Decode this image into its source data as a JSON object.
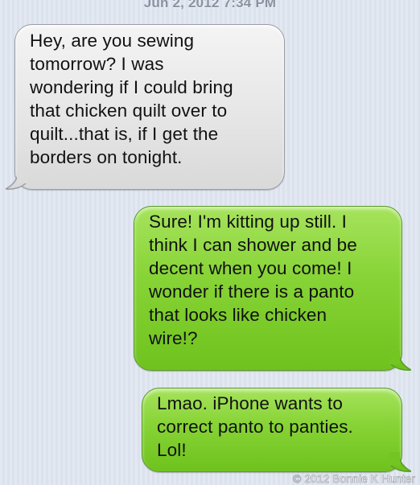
{
  "conversation": {
    "timestamp": "Jun 2, 2012 7:34 PM",
    "messages": [
      {
        "direction": "incoming",
        "text": "Hey, are you sewing\ntomorrow?  I was\nwondering if I could bring\nthat chicken quilt over to\nquilt...that is, if I get the\nborders on tonight."
      },
      {
        "direction": "outgoing",
        "text": "Sure!  I'm kitting up still. I\nthink I can shower and be\ndecent when you come!  I\nwonder if there is a panto\nthat looks like chicken\nwire!?"
      },
      {
        "direction": "outgoing",
        "text": "Lmao. iPhone wants to\ncorrect panto to panties.\nLol!"
      }
    ]
  },
  "watermark": "© 2012 Bonnie K Hunter",
  "colors": {
    "incoming_bubble": "#e6e6e6",
    "outgoing_bubble": "#86d335",
    "background": "#dbe2ed"
  }
}
